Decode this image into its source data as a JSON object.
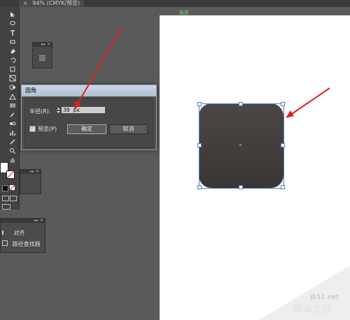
{
  "document_tab": {
    "close": "×",
    "title": "94% (CMYK/预览)"
  },
  "artboard": {
    "label": "画板"
  },
  "dialog": {
    "title": "圆角",
    "radius_label": "半径(R):",
    "radius_value": "30 px",
    "preview_label": "预览(P)",
    "preview_checked": true,
    "ok_label": "确定",
    "cancel_label": "取消"
  },
  "panels": {
    "align_label": "对齐",
    "pathfinder_label": "路径查找器"
  },
  "watermark": {
    "url": "jb51.net",
    "text": "脚本之家"
  },
  "colors": {
    "selection": "#4a7fd6",
    "arrow": "#e02020",
    "shape_fill": "#413d3b",
    "artboard_label": "#6ed26e"
  },
  "icons": [
    "close-icon",
    "selection-tool-icon",
    "pen-tool-icon",
    "type-tool-icon",
    "arrow-annotation-icon"
  ]
}
